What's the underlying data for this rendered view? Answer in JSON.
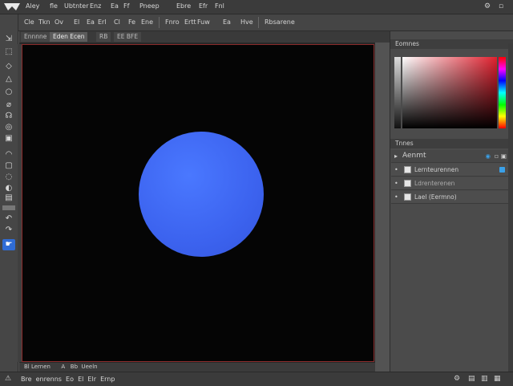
{
  "menubar": {
    "items": [
      "Aley",
      "fle",
      "Ubtnter",
      "Enz",
      "Ea",
      "Ff",
      "Pneep",
      "Ebre",
      "Efr",
      "Fnl"
    ],
    "icons": [
      "minimize-icon",
      "restore-icon",
      "close-icon"
    ]
  },
  "options": {
    "items": [
      "Cle",
      "Tkn",
      "Ov",
      "El",
      "Ea",
      "Erl",
      "Cl",
      "Fe",
      "Ene",
      "Fnro",
      "Ertt",
      "Fuw",
      "Ea",
      "Hve",
      "Rbsarene"
    ]
  },
  "tabs": [
    "Ennnne",
    "Eden Ecen",
    "RB",
    "EE BFE"
  ],
  "tools": [
    "move-icon",
    "select-icon",
    "lasso-icon",
    "triangle-icon",
    "crop-icon",
    "eyedropper-icon",
    "heal-icon",
    "brush-icon",
    "stamp-icon",
    "history-icon",
    "eraser-icon",
    "gradient-icon",
    "blur-icon",
    "dodge-icon",
    "pen-icon",
    "type-icon",
    "path-icon",
    "shape-icon",
    "hand-icon",
    "zoom-icon"
  ],
  "panels": {
    "color": {
      "title": "Eomnes"
    },
    "layers": {
      "title": "Tnnes",
      "header": "Aenmt",
      "rows": [
        "Lernteurennen",
        "Ldrenterenen",
        "Lael (Eermno)"
      ]
    }
  },
  "docstatus": "Bl Lernen      A   Bb  Ueeln",
  "bottombar": {
    "text": "Bre  enrenns  Eo  El  Elr  Ernp"
  }
}
